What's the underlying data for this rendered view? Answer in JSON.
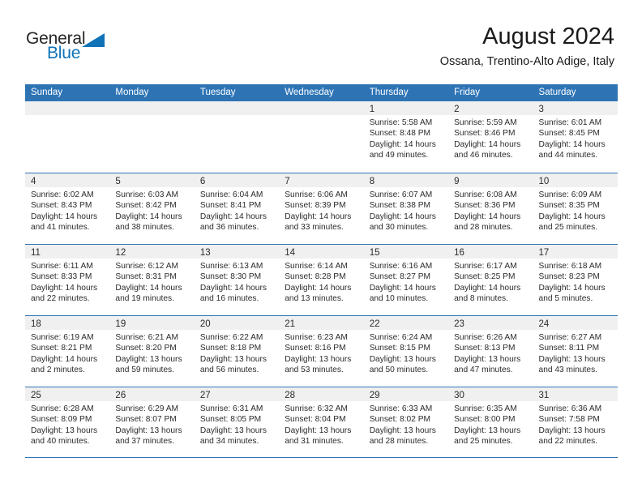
{
  "brand": {
    "name_top": "General",
    "name_bottom": "Blue",
    "accent_color": "#1073b8"
  },
  "header": {
    "month_title": "August 2024",
    "location": "Ossana, Trentino-Alto Adige, Italy",
    "header_bg_color": "#2e74b5"
  },
  "calendar": {
    "day_headers": [
      "Sunday",
      "Monday",
      "Tuesday",
      "Wednesday",
      "Thursday",
      "Friday",
      "Saturday"
    ],
    "weeks": [
      [
        {
          "day": "",
          "empty": true
        },
        {
          "day": "",
          "empty": true
        },
        {
          "day": "",
          "empty": true
        },
        {
          "day": "",
          "empty": true
        },
        {
          "day": "1",
          "sunrise": "Sunrise: 5:58 AM",
          "sunset": "Sunset: 8:48 PM",
          "daylight_line1": "Daylight: 14 hours",
          "daylight_line2": "and 49 minutes."
        },
        {
          "day": "2",
          "sunrise": "Sunrise: 5:59 AM",
          "sunset": "Sunset: 8:46 PM",
          "daylight_line1": "Daylight: 14 hours",
          "daylight_line2": "and 46 minutes."
        },
        {
          "day": "3",
          "sunrise": "Sunrise: 6:01 AM",
          "sunset": "Sunset: 8:45 PM",
          "daylight_line1": "Daylight: 14 hours",
          "daylight_line2": "and 44 minutes."
        }
      ],
      [
        {
          "day": "4",
          "sunrise": "Sunrise: 6:02 AM",
          "sunset": "Sunset: 8:43 PM",
          "daylight_line1": "Daylight: 14 hours",
          "daylight_line2": "and 41 minutes."
        },
        {
          "day": "5",
          "sunrise": "Sunrise: 6:03 AM",
          "sunset": "Sunset: 8:42 PM",
          "daylight_line1": "Daylight: 14 hours",
          "daylight_line2": "and 38 minutes."
        },
        {
          "day": "6",
          "sunrise": "Sunrise: 6:04 AM",
          "sunset": "Sunset: 8:41 PM",
          "daylight_line1": "Daylight: 14 hours",
          "daylight_line2": "and 36 minutes."
        },
        {
          "day": "7",
          "sunrise": "Sunrise: 6:06 AM",
          "sunset": "Sunset: 8:39 PM",
          "daylight_line1": "Daylight: 14 hours",
          "daylight_line2": "and 33 minutes."
        },
        {
          "day": "8",
          "sunrise": "Sunrise: 6:07 AM",
          "sunset": "Sunset: 8:38 PM",
          "daylight_line1": "Daylight: 14 hours",
          "daylight_line2": "and 30 minutes."
        },
        {
          "day": "9",
          "sunrise": "Sunrise: 6:08 AM",
          "sunset": "Sunset: 8:36 PM",
          "daylight_line1": "Daylight: 14 hours",
          "daylight_line2": "and 28 minutes."
        },
        {
          "day": "10",
          "sunrise": "Sunrise: 6:09 AM",
          "sunset": "Sunset: 8:35 PM",
          "daylight_line1": "Daylight: 14 hours",
          "daylight_line2": "and 25 minutes."
        }
      ],
      [
        {
          "day": "11",
          "sunrise": "Sunrise: 6:11 AM",
          "sunset": "Sunset: 8:33 PM",
          "daylight_line1": "Daylight: 14 hours",
          "daylight_line2": "and 22 minutes."
        },
        {
          "day": "12",
          "sunrise": "Sunrise: 6:12 AM",
          "sunset": "Sunset: 8:31 PM",
          "daylight_line1": "Daylight: 14 hours",
          "daylight_line2": "and 19 minutes."
        },
        {
          "day": "13",
          "sunrise": "Sunrise: 6:13 AM",
          "sunset": "Sunset: 8:30 PM",
          "daylight_line1": "Daylight: 14 hours",
          "daylight_line2": "and 16 minutes."
        },
        {
          "day": "14",
          "sunrise": "Sunrise: 6:14 AM",
          "sunset": "Sunset: 8:28 PM",
          "daylight_line1": "Daylight: 14 hours",
          "daylight_line2": "and 13 minutes."
        },
        {
          "day": "15",
          "sunrise": "Sunrise: 6:16 AM",
          "sunset": "Sunset: 8:27 PM",
          "daylight_line1": "Daylight: 14 hours",
          "daylight_line2": "and 10 minutes."
        },
        {
          "day": "16",
          "sunrise": "Sunrise: 6:17 AM",
          "sunset": "Sunset: 8:25 PM",
          "daylight_line1": "Daylight: 14 hours",
          "daylight_line2": "and 8 minutes."
        },
        {
          "day": "17",
          "sunrise": "Sunrise: 6:18 AM",
          "sunset": "Sunset: 8:23 PM",
          "daylight_line1": "Daylight: 14 hours",
          "daylight_line2": "and 5 minutes."
        }
      ],
      [
        {
          "day": "18",
          "sunrise": "Sunrise: 6:19 AM",
          "sunset": "Sunset: 8:21 PM",
          "daylight_line1": "Daylight: 14 hours",
          "daylight_line2": "and 2 minutes."
        },
        {
          "day": "19",
          "sunrise": "Sunrise: 6:21 AM",
          "sunset": "Sunset: 8:20 PM",
          "daylight_line1": "Daylight: 13 hours",
          "daylight_line2": "and 59 minutes."
        },
        {
          "day": "20",
          "sunrise": "Sunrise: 6:22 AM",
          "sunset": "Sunset: 8:18 PM",
          "daylight_line1": "Daylight: 13 hours",
          "daylight_line2": "and 56 minutes."
        },
        {
          "day": "21",
          "sunrise": "Sunrise: 6:23 AM",
          "sunset": "Sunset: 8:16 PM",
          "daylight_line1": "Daylight: 13 hours",
          "daylight_line2": "and 53 minutes."
        },
        {
          "day": "22",
          "sunrise": "Sunrise: 6:24 AM",
          "sunset": "Sunset: 8:15 PM",
          "daylight_line1": "Daylight: 13 hours",
          "daylight_line2": "and 50 minutes."
        },
        {
          "day": "23",
          "sunrise": "Sunrise: 6:26 AM",
          "sunset": "Sunset: 8:13 PM",
          "daylight_line1": "Daylight: 13 hours",
          "daylight_line2": "and 47 minutes."
        },
        {
          "day": "24",
          "sunrise": "Sunrise: 6:27 AM",
          "sunset": "Sunset: 8:11 PM",
          "daylight_line1": "Daylight: 13 hours",
          "daylight_line2": "and 43 minutes."
        }
      ],
      [
        {
          "day": "25",
          "sunrise": "Sunrise: 6:28 AM",
          "sunset": "Sunset: 8:09 PM",
          "daylight_line1": "Daylight: 13 hours",
          "daylight_line2": "and 40 minutes."
        },
        {
          "day": "26",
          "sunrise": "Sunrise: 6:29 AM",
          "sunset": "Sunset: 8:07 PM",
          "daylight_line1": "Daylight: 13 hours",
          "daylight_line2": "and 37 minutes."
        },
        {
          "day": "27",
          "sunrise": "Sunrise: 6:31 AM",
          "sunset": "Sunset: 8:05 PM",
          "daylight_line1": "Daylight: 13 hours",
          "daylight_line2": "and 34 minutes."
        },
        {
          "day": "28",
          "sunrise": "Sunrise: 6:32 AM",
          "sunset": "Sunset: 8:04 PM",
          "daylight_line1": "Daylight: 13 hours",
          "daylight_line2": "and 31 minutes."
        },
        {
          "day": "29",
          "sunrise": "Sunrise: 6:33 AM",
          "sunset": "Sunset: 8:02 PM",
          "daylight_line1": "Daylight: 13 hours",
          "daylight_line2": "and 28 minutes."
        },
        {
          "day": "30",
          "sunrise": "Sunrise: 6:35 AM",
          "sunset": "Sunset: 8:00 PM",
          "daylight_line1": "Daylight: 13 hours",
          "daylight_line2": "and 25 minutes."
        },
        {
          "day": "31",
          "sunrise": "Sunrise: 6:36 AM",
          "sunset": "Sunset: 7:58 PM",
          "daylight_line1": "Daylight: 13 hours",
          "daylight_line2": "and 22 minutes."
        }
      ]
    ]
  }
}
